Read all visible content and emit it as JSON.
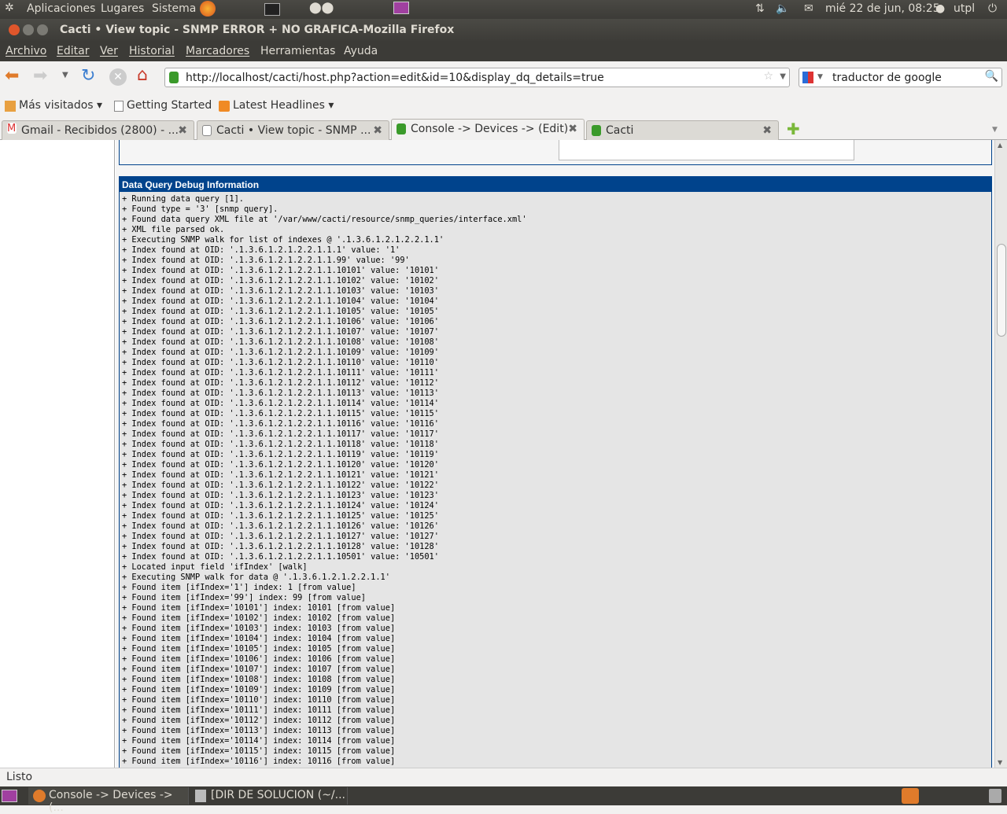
{
  "top_panel": {
    "menus": [
      "Aplicaciones",
      "Lugares",
      "Sistema"
    ],
    "datetime": "mié 22 de jun, 08:25",
    "user": "utpl"
  },
  "window": {
    "title": "Cacti • View topic - SNMP ERROR + NO GRAFICA-Mozilla Firefox"
  },
  "menubar": [
    "Archivo",
    "Editar",
    "Ver",
    "Historial",
    "Marcadores",
    "Herramientas",
    "Ayuda"
  ],
  "navbar": {
    "url": "http://localhost/cacti/host.php?action=edit&id=10&display_dq_details=true",
    "search": "traductor de google"
  },
  "bookmarks": [
    "Más visitados ▾",
    "Getting Started",
    "Latest Headlines ▾"
  ],
  "tabs": [
    {
      "label": "Gmail - Recibidos (2800) - ..."
    },
    {
      "label": "Cacti • View topic - SNMP ..."
    },
    {
      "label": "Console -> Devices -> (Edit)"
    },
    {
      "label": "Cacti"
    }
  ],
  "debug": {
    "title": "Data Query Debug Information",
    "lines": [
      "+ Running data query [1].",
      "+ Found type = '3' [snmp query].",
      "+ Found data query XML file at '/var/www/cacti/resource/snmp_queries/interface.xml'",
      "+ XML file parsed ok.",
      "+ Executing SNMP walk for list of indexes @ '.1.3.6.1.2.1.2.2.1.1'",
      "+ Index found at OID: '.1.3.6.1.2.1.2.2.1.1.1' value: '1'",
      "+ Index found at OID: '.1.3.6.1.2.1.2.2.1.1.99' value: '99'",
      "+ Index found at OID: '.1.3.6.1.2.1.2.2.1.1.10101' value: '10101'",
      "+ Index found at OID: '.1.3.6.1.2.1.2.2.1.1.10102' value: '10102'",
      "+ Index found at OID: '.1.3.6.1.2.1.2.2.1.1.10103' value: '10103'",
      "+ Index found at OID: '.1.3.6.1.2.1.2.2.1.1.10104' value: '10104'",
      "+ Index found at OID: '.1.3.6.1.2.1.2.2.1.1.10105' value: '10105'",
      "+ Index found at OID: '.1.3.6.1.2.1.2.2.1.1.10106' value: '10106'",
      "+ Index found at OID: '.1.3.6.1.2.1.2.2.1.1.10107' value: '10107'",
      "+ Index found at OID: '.1.3.6.1.2.1.2.2.1.1.10108' value: '10108'",
      "+ Index found at OID: '.1.3.6.1.2.1.2.2.1.1.10109' value: '10109'",
      "+ Index found at OID: '.1.3.6.1.2.1.2.2.1.1.10110' value: '10110'",
      "+ Index found at OID: '.1.3.6.1.2.1.2.2.1.1.10111' value: '10111'",
      "+ Index found at OID: '.1.3.6.1.2.1.2.2.1.1.10112' value: '10112'",
      "+ Index found at OID: '.1.3.6.1.2.1.2.2.1.1.10113' value: '10113'",
      "+ Index found at OID: '.1.3.6.1.2.1.2.2.1.1.10114' value: '10114'",
      "+ Index found at OID: '.1.3.6.1.2.1.2.2.1.1.10115' value: '10115'",
      "+ Index found at OID: '.1.3.6.1.2.1.2.2.1.1.10116' value: '10116'",
      "+ Index found at OID: '.1.3.6.1.2.1.2.2.1.1.10117' value: '10117'",
      "+ Index found at OID: '.1.3.6.1.2.1.2.2.1.1.10118' value: '10118'",
      "+ Index found at OID: '.1.3.6.1.2.1.2.2.1.1.10119' value: '10119'",
      "+ Index found at OID: '.1.3.6.1.2.1.2.2.1.1.10120' value: '10120'",
      "+ Index found at OID: '.1.3.6.1.2.1.2.2.1.1.10121' value: '10121'",
      "+ Index found at OID: '.1.3.6.1.2.1.2.2.1.1.10122' value: '10122'",
      "+ Index found at OID: '.1.3.6.1.2.1.2.2.1.1.10123' value: '10123'",
      "+ Index found at OID: '.1.3.6.1.2.1.2.2.1.1.10124' value: '10124'",
      "+ Index found at OID: '.1.3.6.1.2.1.2.2.1.1.10125' value: '10125'",
      "+ Index found at OID: '.1.3.6.1.2.1.2.2.1.1.10126' value: '10126'",
      "+ Index found at OID: '.1.3.6.1.2.1.2.2.1.1.10127' value: '10127'",
      "+ Index found at OID: '.1.3.6.1.2.1.2.2.1.1.10128' value: '10128'",
      "+ Index found at OID: '.1.3.6.1.2.1.2.2.1.1.10501' value: '10501'",
      "+ Located input field 'ifIndex' [walk]",
      "+ Executing SNMP walk for data @ '.1.3.6.1.2.1.2.2.1.1'",
      "+ Found item [ifIndex='1'] index: 1 [from value]",
      "+ Found item [ifIndex='99'] index: 99 [from value]",
      "+ Found item [ifIndex='10101'] index: 10101 [from value]",
      "+ Found item [ifIndex='10102'] index: 10102 [from value]",
      "+ Found item [ifIndex='10103'] index: 10103 [from value]",
      "+ Found item [ifIndex='10104'] index: 10104 [from value]",
      "+ Found item [ifIndex='10105'] index: 10105 [from value]",
      "+ Found item [ifIndex='10106'] index: 10106 [from value]",
      "+ Found item [ifIndex='10107'] index: 10107 [from value]",
      "+ Found item [ifIndex='10108'] index: 10108 [from value]",
      "+ Found item [ifIndex='10109'] index: 10109 [from value]",
      "+ Found item [ifIndex='10110'] index: 10110 [from value]",
      "+ Found item [ifIndex='10111'] index: 10111 [from value]",
      "+ Found item [ifIndex='10112'] index: 10112 [from value]",
      "+ Found item [ifIndex='10113'] index: 10113 [from value]",
      "+ Found item [ifIndex='10114'] index: 10114 [from value]",
      "+ Found item [ifIndex='10115'] index: 10115 [from value]",
      "+ Found item [ifIndex='10116'] index: 10116 [from value]"
    ]
  },
  "status": "Listo",
  "taskbar": [
    "Console -> Devices -> (...",
    "[DIR DE SOLUCION (~/..."
  ],
  "colors": {
    "header_blue": "#00438c",
    "panel_dark": "#3c3b37"
  }
}
